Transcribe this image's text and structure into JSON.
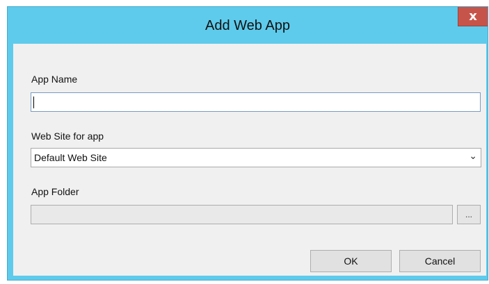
{
  "window": {
    "title": "Add Web App",
    "close_glyph": "x"
  },
  "form": {
    "app_name": {
      "label": "App Name",
      "value": ""
    },
    "web_site": {
      "label": "Web Site for app",
      "selected": "Default Web Site",
      "chevron": "⌄"
    },
    "app_folder": {
      "label": "App Folder",
      "value": "",
      "browse_label": "..."
    }
  },
  "buttons": {
    "ok_label": "OK",
    "cancel_label": "Cancel"
  },
  "colors": {
    "titlebar": "#5ecbec",
    "close_button": "#c7544a",
    "client_background": "#f0f0f0"
  }
}
